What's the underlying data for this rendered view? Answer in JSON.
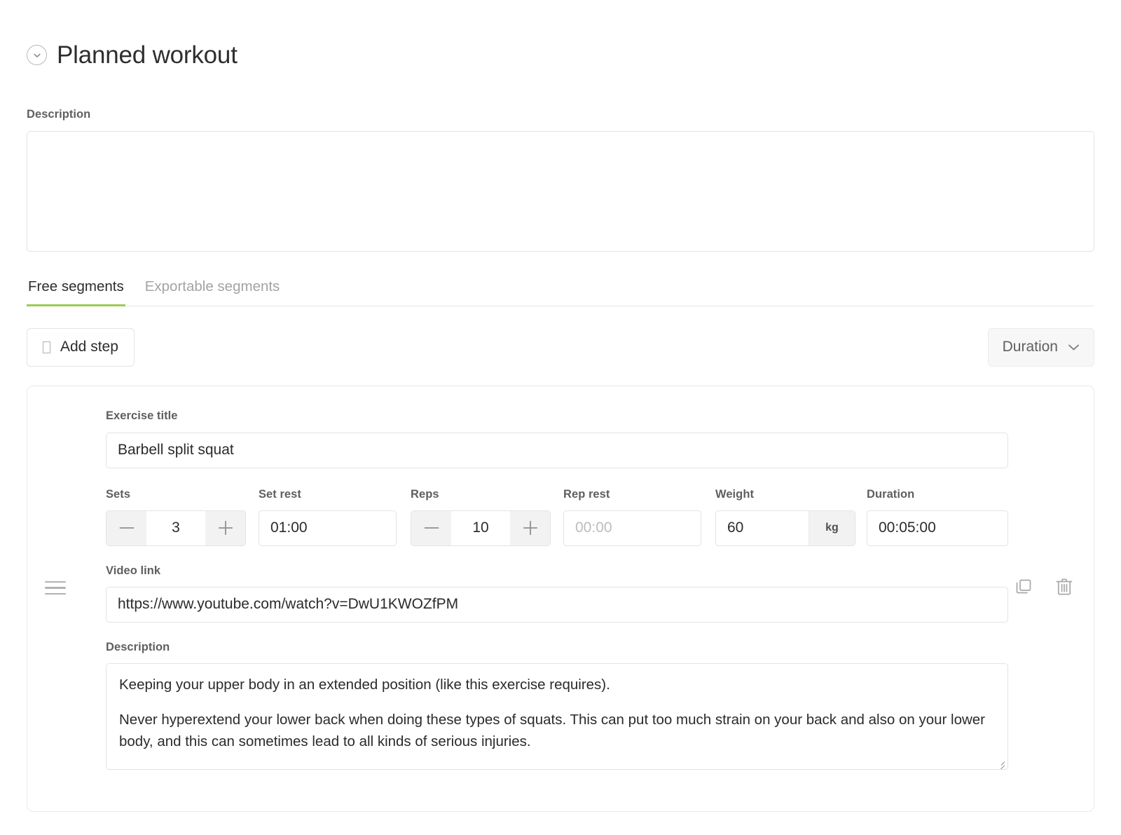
{
  "header": {
    "title": "Planned workout",
    "collapse_icon": "chevron-down-circle-icon"
  },
  "description_block": {
    "label": "Description",
    "value": "",
    "placeholder": ""
  },
  "tabs": [
    {
      "label": "Free segments",
      "active": true
    },
    {
      "label": "Exportable segments",
      "active": false
    }
  ],
  "toolbar": {
    "add_step_label": "Add step",
    "add_step_icon": "missing-glyph-icon",
    "duration_select_value": "Duration",
    "duration_select_icon": "chevron-down-icon"
  },
  "exercise": {
    "drag_handle_icon": "drag-handle-icon",
    "title_label": "Exercise title",
    "title_value": "Barbell split squat",
    "metrics": {
      "sets": {
        "label": "Sets",
        "value": "3",
        "minus": "—",
        "plus": "+"
      },
      "set_rest": {
        "label": "Set rest",
        "value": "01:00"
      },
      "reps": {
        "label": "Reps",
        "value": "10",
        "minus": "—",
        "plus": "+"
      },
      "rep_rest": {
        "label": "Rep rest",
        "value": "",
        "placeholder": "00:00"
      },
      "weight": {
        "label": "Weight",
        "value": "60",
        "unit": "kg"
      },
      "duration": {
        "label": "Duration",
        "value": "00:05:00"
      }
    },
    "video_link_label": "Video link",
    "video_link_value": "https://www.youtube.com/watch?v=DwU1KWOZfPM",
    "description_label": "Description",
    "description_p1": "Keeping your upper body in an extended position (like this exercise requires).",
    "description_p2": "Never hyperextend your lower back when doing these types of squats. This can put too much strain on your back and also on your lower body, and this can sometimes lead to all kinds of serious injuries.",
    "copy_icon": "copy-icon",
    "delete_icon": "trash-icon"
  },
  "colors": {
    "accent_green": "#9ccc51",
    "border": "#e3e3e3",
    "muted_text": "#a3a3a3",
    "label_text": "#5f5f5f"
  }
}
